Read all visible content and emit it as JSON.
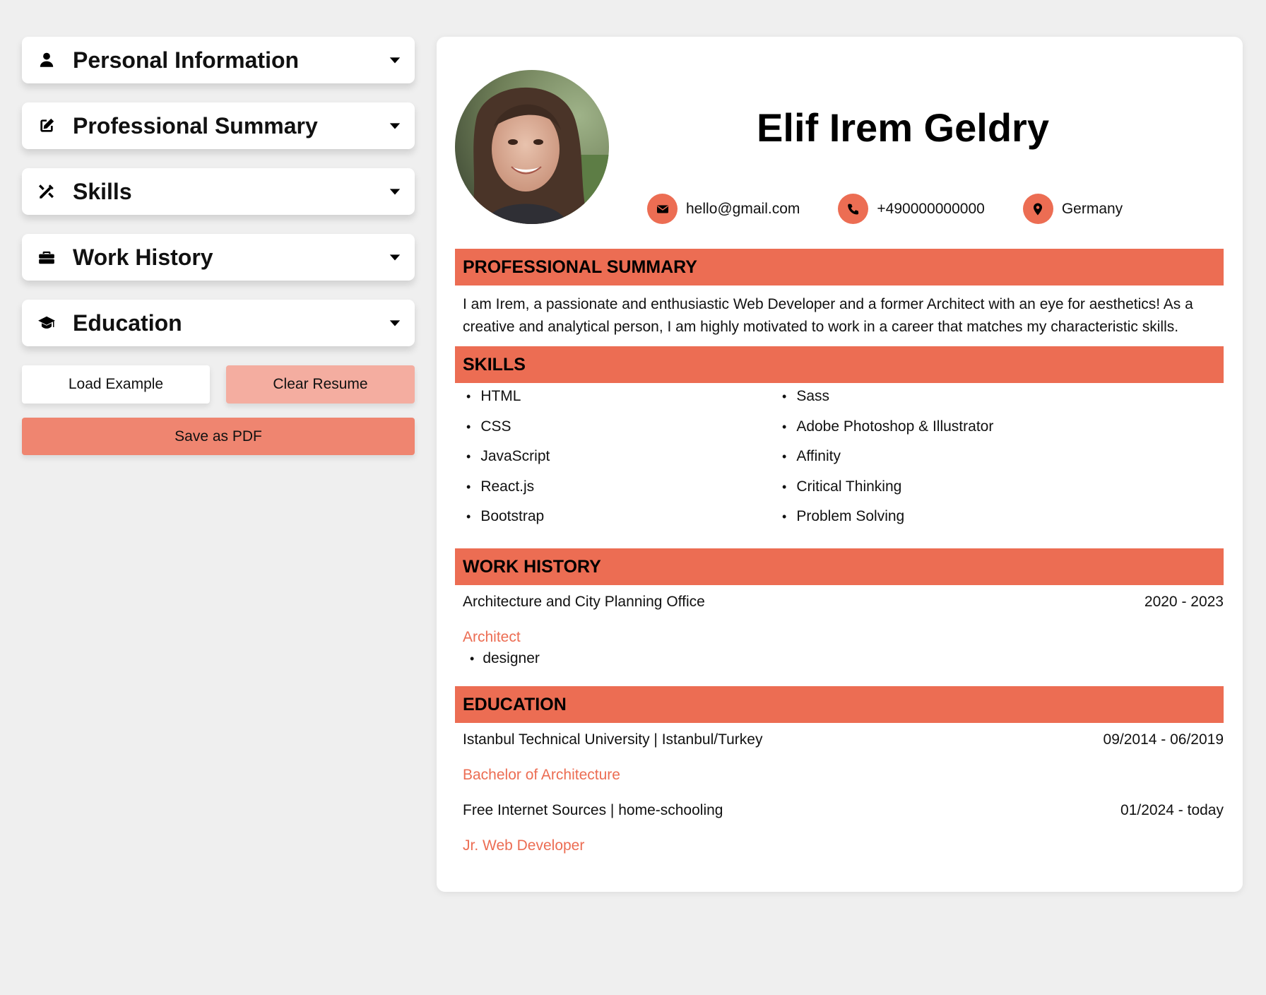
{
  "sidebar": {
    "sections": [
      {
        "label": "Personal Information",
        "icon": "user-icon"
      },
      {
        "label": "Professional Summary",
        "icon": "edit-icon"
      },
      {
        "label": "Skills",
        "icon": "tools-icon"
      },
      {
        "label": "Work History",
        "icon": "briefcase-icon"
      },
      {
        "label": "Education",
        "icon": "graduation-cap-icon"
      }
    ],
    "load_example_label": "Load Example",
    "clear_resume_label": "Clear Resume",
    "save_pdf_label": "Save as PDF"
  },
  "resume": {
    "name": "Elif Irem Geldry",
    "contacts": {
      "email": "hello@gmail.com",
      "phone": "+490000000000",
      "location": "Germany"
    },
    "headings": {
      "summary": "PROFESSIONAL SUMMARY",
      "skills": "SKILLS",
      "work": "WORK HISTORY",
      "education": "EDUCATION"
    },
    "summary": "I am Irem, a passionate and enthusiastic Web Developer and a former Architect with an eye for aesthetics! As a creative and analytical person, I am highly motivated to work in a career that matches my characteristic skills.",
    "skills_left": [
      "HTML",
      "CSS",
      "JavaScript",
      "React.js",
      "Bootstrap"
    ],
    "skills_right": [
      "Sass",
      "Adobe Photoshop & Illustrator",
      "Affinity",
      "Critical Thinking",
      "Problem Solving"
    ],
    "work": [
      {
        "company": "Architecture and City Planning Office",
        "dates": "2020 - 2023",
        "title": "Architect",
        "tasks": [
          "designer"
        ]
      }
    ],
    "education": [
      {
        "school": "Istanbul Technical University | Istanbul/Turkey",
        "dates": "09/2014 - 06/2019",
        "degree": "Bachelor of Architecture"
      },
      {
        "school": "Free Internet Sources | home-schooling",
        "dates": "01/2024 - today",
        "degree": "Jr. Web Developer"
      }
    ]
  },
  "colors": {
    "accent": "#ec6d53",
    "clear_button": "#f4ada0",
    "pdf_button": "#ef8570",
    "background": "#efefef"
  }
}
